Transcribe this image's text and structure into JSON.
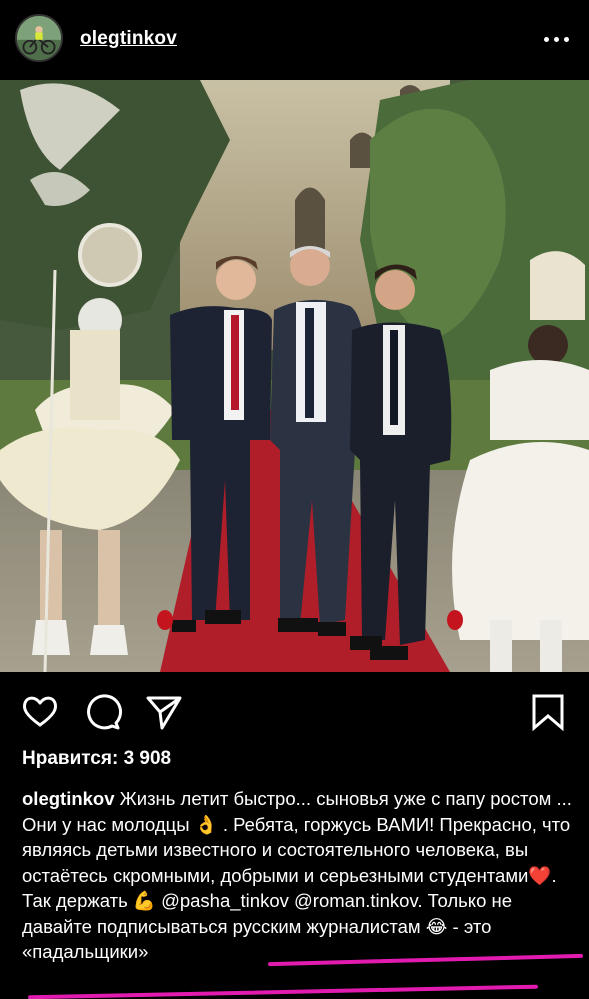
{
  "header": {
    "username": "olegtinkov",
    "more_icon": "more-horizontal-icon"
  },
  "post": {
    "photo_alt": "",
    "likes_label": "Нравится: 3 908",
    "caption": {
      "username": "olegtinkov",
      "text_1": "Жизнь летит быстро... сыновья уже с папу ростом ... Они у нас молодцы",
      "emoji_ok": "👌",
      "text_2": ". Ребята, горжусь ВАМИ! Прекрасно, что являясь детьми известного и состоятельного человека, вы остаётесь скромными, добрыми и серьезными студентами",
      "emoji_heart": "❤️",
      "text_3": ". Так держать",
      "emoji_muscle": "💪",
      "mention_1": "@pasha_tinkov",
      "mention_2": "@roman.tinkov",
      "text_4": ". Только не давайте подписываться русским журналистам",
      "emoji_laugh": "😂",
      "text_5": " - это «падальщики»"
    }
  },
  "actions": {
    "like_icon": "heart-icon",
    "comment_icon": "comment-icon",
    "share_icon": "send-icon",
    "save_icon": "bookmark-icon"
  },
  "colors": {
    "background": "#000000",
    "text": "#ffffff",
    "annotation": "#e21bb0"
  }
}
